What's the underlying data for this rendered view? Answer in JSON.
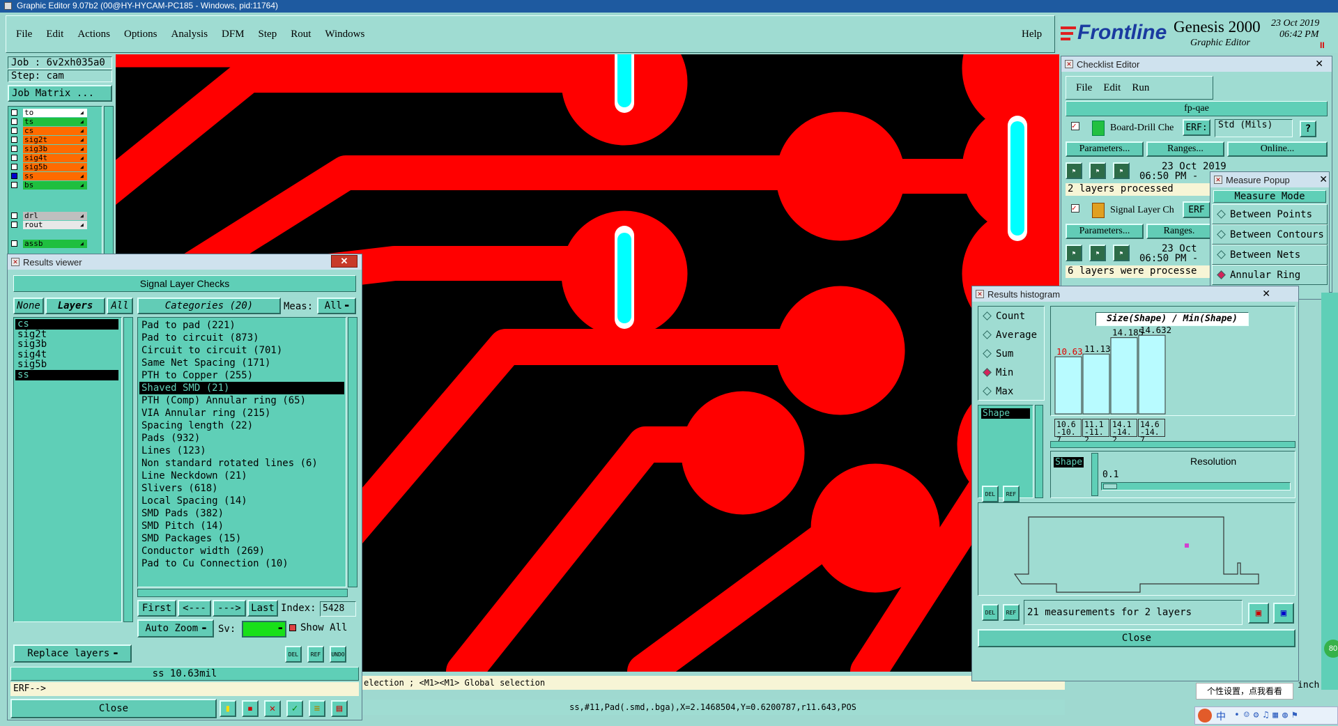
{
  "window": {
    "title": "Graphic Editor 9.07b2 (00@HY-HYCAM-PC185 - Windows, pid:11764)"
  },
  "menu": [
    "File",
    "Edit",
    "Actions",
    "Options",
    "Analysis",
    "DFM",
    "Step",
    "Rout",
    "Windows"
  ],
  "help": "Help",
  "brand": {
    "logo": "Frontline",
    "product": "Genesis 2000",
    "sub": "Graphic Editor",
    "date": "23 Oct 2019",
    "time": "06:42 PM",
    "pause": "II"
  },
  "job": {
    "job": "Job : 6v2xh035a0",
    "step": "Step: cam",
    "matrix": "Job Matrix ..."
  },
  "layers": [
    {
      "name": "to",
      "color": "#ffffff"
    },
    {
      "name": "ts",
      "color": "#1fbf3f"
    },
    {
      "name": "cs",
      "color": "#ff6b00"
    },
    {
      "name": "sig2t",
      "color": "#ff6b00"
    },
    {
      "name": "sig3b",
      "color": "#ff6b00"
    },
    {
      "name": "sig4t",
      "color": "#ff6b00"
    },
    {
      "name": "sig5b",
      "color": "#ff6b00"
    },
    {
      "name": "ss",
      "color": "#ff6b00"
    },
    {
      "name": "bs",
      "color": "#1fbf3f"
    }
  ],
  "layers2": [
    {
      "name": "drl",
      "color": "#bfbfbf"
    },
    {
      "name": "rout",
      "color": "#e8e8e8"
    },
    {
      "name": "assb",
      "color": "#1fbf3f"
    }
  ],
  "results": {
    "title": "Results viewer",
    "header": "Signal Layer Checks",
    "none": "None",
    "layers": "Layers",
    "all": "All",
    "categories": "Categories (20)",
    "meas": "Meas:",
    "meas_val": "All",
    "layer_list": [
      "cs",
      "sig2t",
      "sig3b",
      "sig4t",
      "sig5b",
      "ss"
    ],
    "cats": [
      "Pad to pad (221)",
      "Pad to circuit (873)",
      "Circuit to circuit (701)",
      "Same Net Spacing (171)",
      "PTH to Copper (255)",
      "Shaved SMD (21)",
      "PTH (Comp) Annular ring (65)",
      "VIA Annular ring (215)",
      "Spacing length (22)",
      "Pads (932)",
      "Lines (123)",
      "Non standard rotated lines (6)",
      "Line Neckdown (21)",
      "Slivers (618)",
      "Local Spacing (14)",
      "SMD Pads (382)",
      "SMD Pitch (14)",
      "SMD Packages (15)",
      "Conductor width (269)",
      "Pad to Cu Connection (10)"
    ],
    "first": "First",
    "prev": "<---",
    "next": "--->",
    "last": "Last",
    "index": "Index:",
    "index_val": "5428",
    "autozoom": "Auto Zoom",
    "sv": "Sv:",
    "showall": "Show All",
    "replace": "Replace layers",
    "status": "ss 10.63mil",
    "erf": "ERF-->",
    "close": "Close",
    "del": "DEL",
    "ref": "REF",
    "undo": "UNDO"
  },
  "statusbar": {
    "sel": "election ; <M1><M1> Global selection",
    "coords": "ss,#11,Pad(.smd,.bga),X=2.1468504,Y=0.6200787,r11.643,POS"
  },
  "checklist": {
    "title": "Checklist Editor",
    "menu": [
      "File",
      "Edit",
      "Run"
    ],
    "name": "fp-qae",
    "row1": {
      "label": "Board-Drill Che",
      "erf": "ERF:",
      "std": "Std (Mils)",
      "q": "?"
    },
    "params": "Parameters...",
    "ranges": "Ranges...",
    "online": "Online...",
    "d1": "23 Oct 2019",
    "t1": "06:50 PM -",
    "m1": "2 layers processed",
    "row2": {
      "label": "Signal Layer Ch",
      "erf": "ERF"
    },
    "ranges2": "Ranges.",
    "d2": "23 Oct",
    "t2": "06:50 PM -",
    "m2": "6 layers were processe"
  },
  "measure": {
    "title": "Measure Popup",
    "mode": "Measure Mode",
    "items": [
      "Between Points",
      "Between Contours",
      "Between Nets",
      "Annular Ring"
    ],
    "selected": 3,
    "tail": "ints"
  },
  "histogram": {
    "title": "Results histogram",
    "modes": [
      "Count",
      "Average",
      "Sum",
      "Min",
      "Max"
    ],
    "selected": 3,
    "shape": "Shape",
    "chart_title": "Size(Shape) / Min(Shape)",
    "bars": [
      {
        "label": "10.63",
        "value": 10.63,
        "range": "10.6-10.7"
      },
      {
        "label": "11.131",
        "value": 11.131,
        "range": "11.1-11.2"
      },
      {
        "label": "14.185",
        "value": 14.185,
        "range": "14.1-14.2"
      },
      {
        "label": "14.632",
        "value": 14.632,
        "range": "14.6-14.7"
      }
    ],
    "res_label": "Resolution",
    "res_val": "0.1",
    "count": "21 measurements for 2 layers",
    "close": "Close",
    "del": "DEL",
    "ref": "REF"
  },
  "misc": {
    "inch": "inch",
    "ime": "个性设置，点我看看",
    "ime2": "中",
    "badge": "80"
  },
  "colors": {
    "copper": "#ff0000",
    "drill": "#00ffff",
    "bg": "#000000",
    "panel": "#5fcfb7"
  }
}
